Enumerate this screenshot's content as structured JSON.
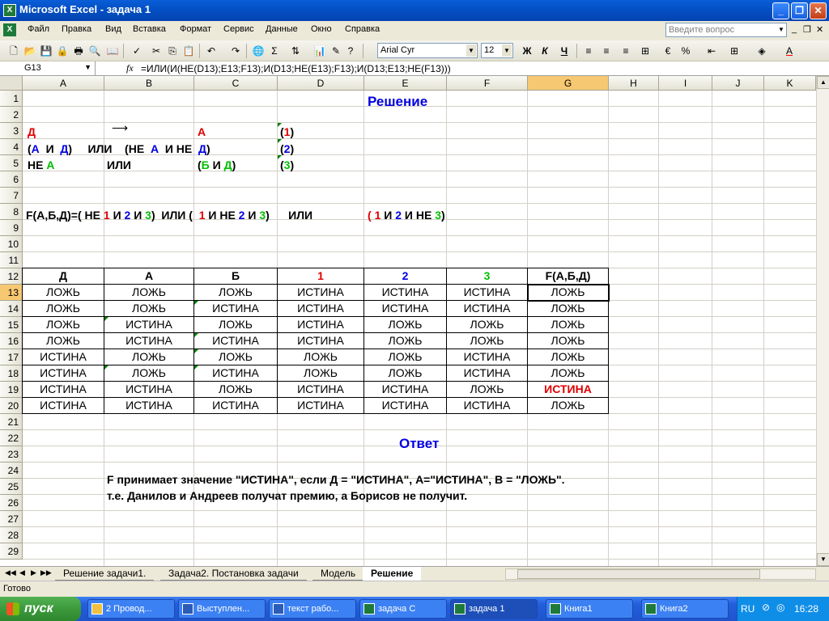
{
  "window": {
    "title": "Microsoft Excel - задача 1"
  },
  "menu": [
    "Файл",
    "Правка",
    "Вид",
    "Вставка",
    "Формат",
    "Сервис",
    "Данные",
    "Окно",
    "Справка"
  ],
  "help_placeholder": "Введите вопрос",
  "toolbar": {
    "font": "Arial Cyr",
    "size": "12",
    "bold": "Ж",
    "italic": "К",
    "underline": "Ч",
    "percent": "%",
    "sigma": "Σ"
  },
  "formula_bar": {
    "name_box": "G13",
    "fx": "fx",
    "formula": "=ИЛИ(И(НЕ(D13);E13;F13);И(D13;НЕ(E13);F13);И(D13;E13;НЕ(F13)))"
  },
  "columns": [
    "A",
    "B",
    "C",
    "D",
    "E",
    "F",
    "G",
    "H",
    "I",
    "J",
    "K"
  ],
  "rows": [
    "1",
    "2",
    "3",
    "4",
    "5",
    "6",
    "7",
    "8",
    "9",
    "10",
    "11",
    "12",
    "13",
    "14",
    "15",
    "16",
    "17",
    "18",
    "19",
    "20",
    "21",
    "22",
    "23",
    "24",
    "25",
    "26",
    "27",
    "28",
    "29"
  ],
  "sheet": {
    "heading": "Решение",
    "r3": {
      "a": "Д",
      "c": "А",
      "d_open": "(",
      "d_num": "1",
      "d_close": ")"
    },
    "r4": {
      "p1": "(",
      "a": "А",
      "and1": "И",
      "d": "Д",
      "close1": ")",
      "or": "ИЛИ",
      "p2": "(НЕ",
      "a2": "А",
      "and2": "И НЕ",
      "d2": "Д",
      "close2": ")",
      "d_open": "(",
      "d_num": "2",
      "d_close": ")"
    },
    "r5": {
      "ne": "НЕ",
      "a": "А",
      "or": "ИЛИ",
      "p": "(",
      "b": "Б",
      "and": "И",
      "d": "Д",
      "close": ")",
      "d_open": "(",
      "d_num": "3",
      "d_close": ")"
    },
    "r8": {
      "fn": "F(А,Б,Д)=( НЕ",
      "n1": "1",
      "and1": "И",
      "n2": "2",
      "and2": "И",
      "n3": "3",
      "c1": ")",
      "or1": "ИЛИ (",
      "m1": "1",
      "mand1": "И НЕ",
      "m2": "2",
      "mand2": "И",
      "m3": "3",
      "c2": ")",
      "or2": "ИЛИ",
      "o1": "(",
      "k1": "1",
      "kand1": "И",
      "k2": "2",
      "kand2": "И НЕ",
      "k3": "3",
      "c3": ")"
    },
    "table_headers": [
      "Д",
      "А",
      "Б",
      "1",
      "2",
      "3",
      "F(А,Б,Д)"
    ],
    "table_rows": [
      [
        "ЛОЖЬ",
        "ЛОЖЬ",
        "ЛОЖЬ",
        "ИСТИНА",
        "ИСТИНА",
        "ИСТИНА",
        "ЛОЖЬ"
      ],
      [
        "ЛОЖЬ",
        "ЛОЖЬ",
        "ИСТИНА",
        "ИСТИНА",
        "ИСТИНА",
        "ИСТИНА",
        "ЛОЖЬ"
      ],
      [
        "ЛОЖЬ",
        "ИСТИНА",
        "ЛОЖЬ",
        "ИСТИНА",
        "ЛОЖЬ",
        "ЛОЖЬ",
        "ЛОЖЬ"
      ],
      [
        "ЛОЖЬ",
        "ИСТИНА",
        "ИСТИНА",
        "ИСТИНА",
        "ЛОЖЬ",
        "ЛОЖЬ",
        "ЛОЖЬ"
      ],
      [
        "ИСТИНА",
        "ЛОЖЬ",
        "ЛОЖЬ",
        "ЛОЖЬ",
        "ЛОЖЬ",
        "ИСТИНА",
        "ЛОЖЬ"
      ],
      [
        "ИСТИНА",
        "ЛОЖЬ",
        "ИСТИНА",
        "ЛОЖЬ",
        "ЛОЖЬ",
        "ИСТИНА",
        "ЛОЖЬ"
      ],
      [
        "ИСТИНА",
        "ИСТИНА",
        "ЛОЖЬ",
        "ИСТИНА",
        "ИСТИНА",
        "ЛОЖЬ",
        "ИСТИНА"
      ],
      [
        "ИСТИНА",
        "ИСТИНА",
        "ИСТИНА",
        "ИСТИНА",
        "ИСТИНА",
        "ИСТИНА",
        "ЛОЖЬ"
      ]
    ],
    "answer_heading": "Ответ",
    "answer_line1": "F принимает значение \"ИСТИНА\", если Д = \"ИСТИНА\", А=\"ИСТИНА\", В = \"ЛОЖЬ\".",
    "answer_line2": "т.е. Данилов и Андреев получат премию, а Борисов не получит."
  },
  "sheet_tabs": [
    "Решение задачи1.",
    "Задача2. Постановка задачи",
    "Модель",
    "Решение"
  ],
  "status": "Готово",
  "taskbar": {
    "start": "пуск",
    "tasks": [
      "2 Провод...",
      "Выступлен...",
      "текст рабо...",
      "задача С",
      "задача 1",
      "Книга1",
      "Книга2"
    ],
    "lang": "RU",
    "clock": "16:28"
  },
  "colors": {
    "accent_red": "#e00000",
    "accent_blue": "#0000e0",
    "accent_green": "#00c000",
    "selected_header": "#f7c872"
  }
}
